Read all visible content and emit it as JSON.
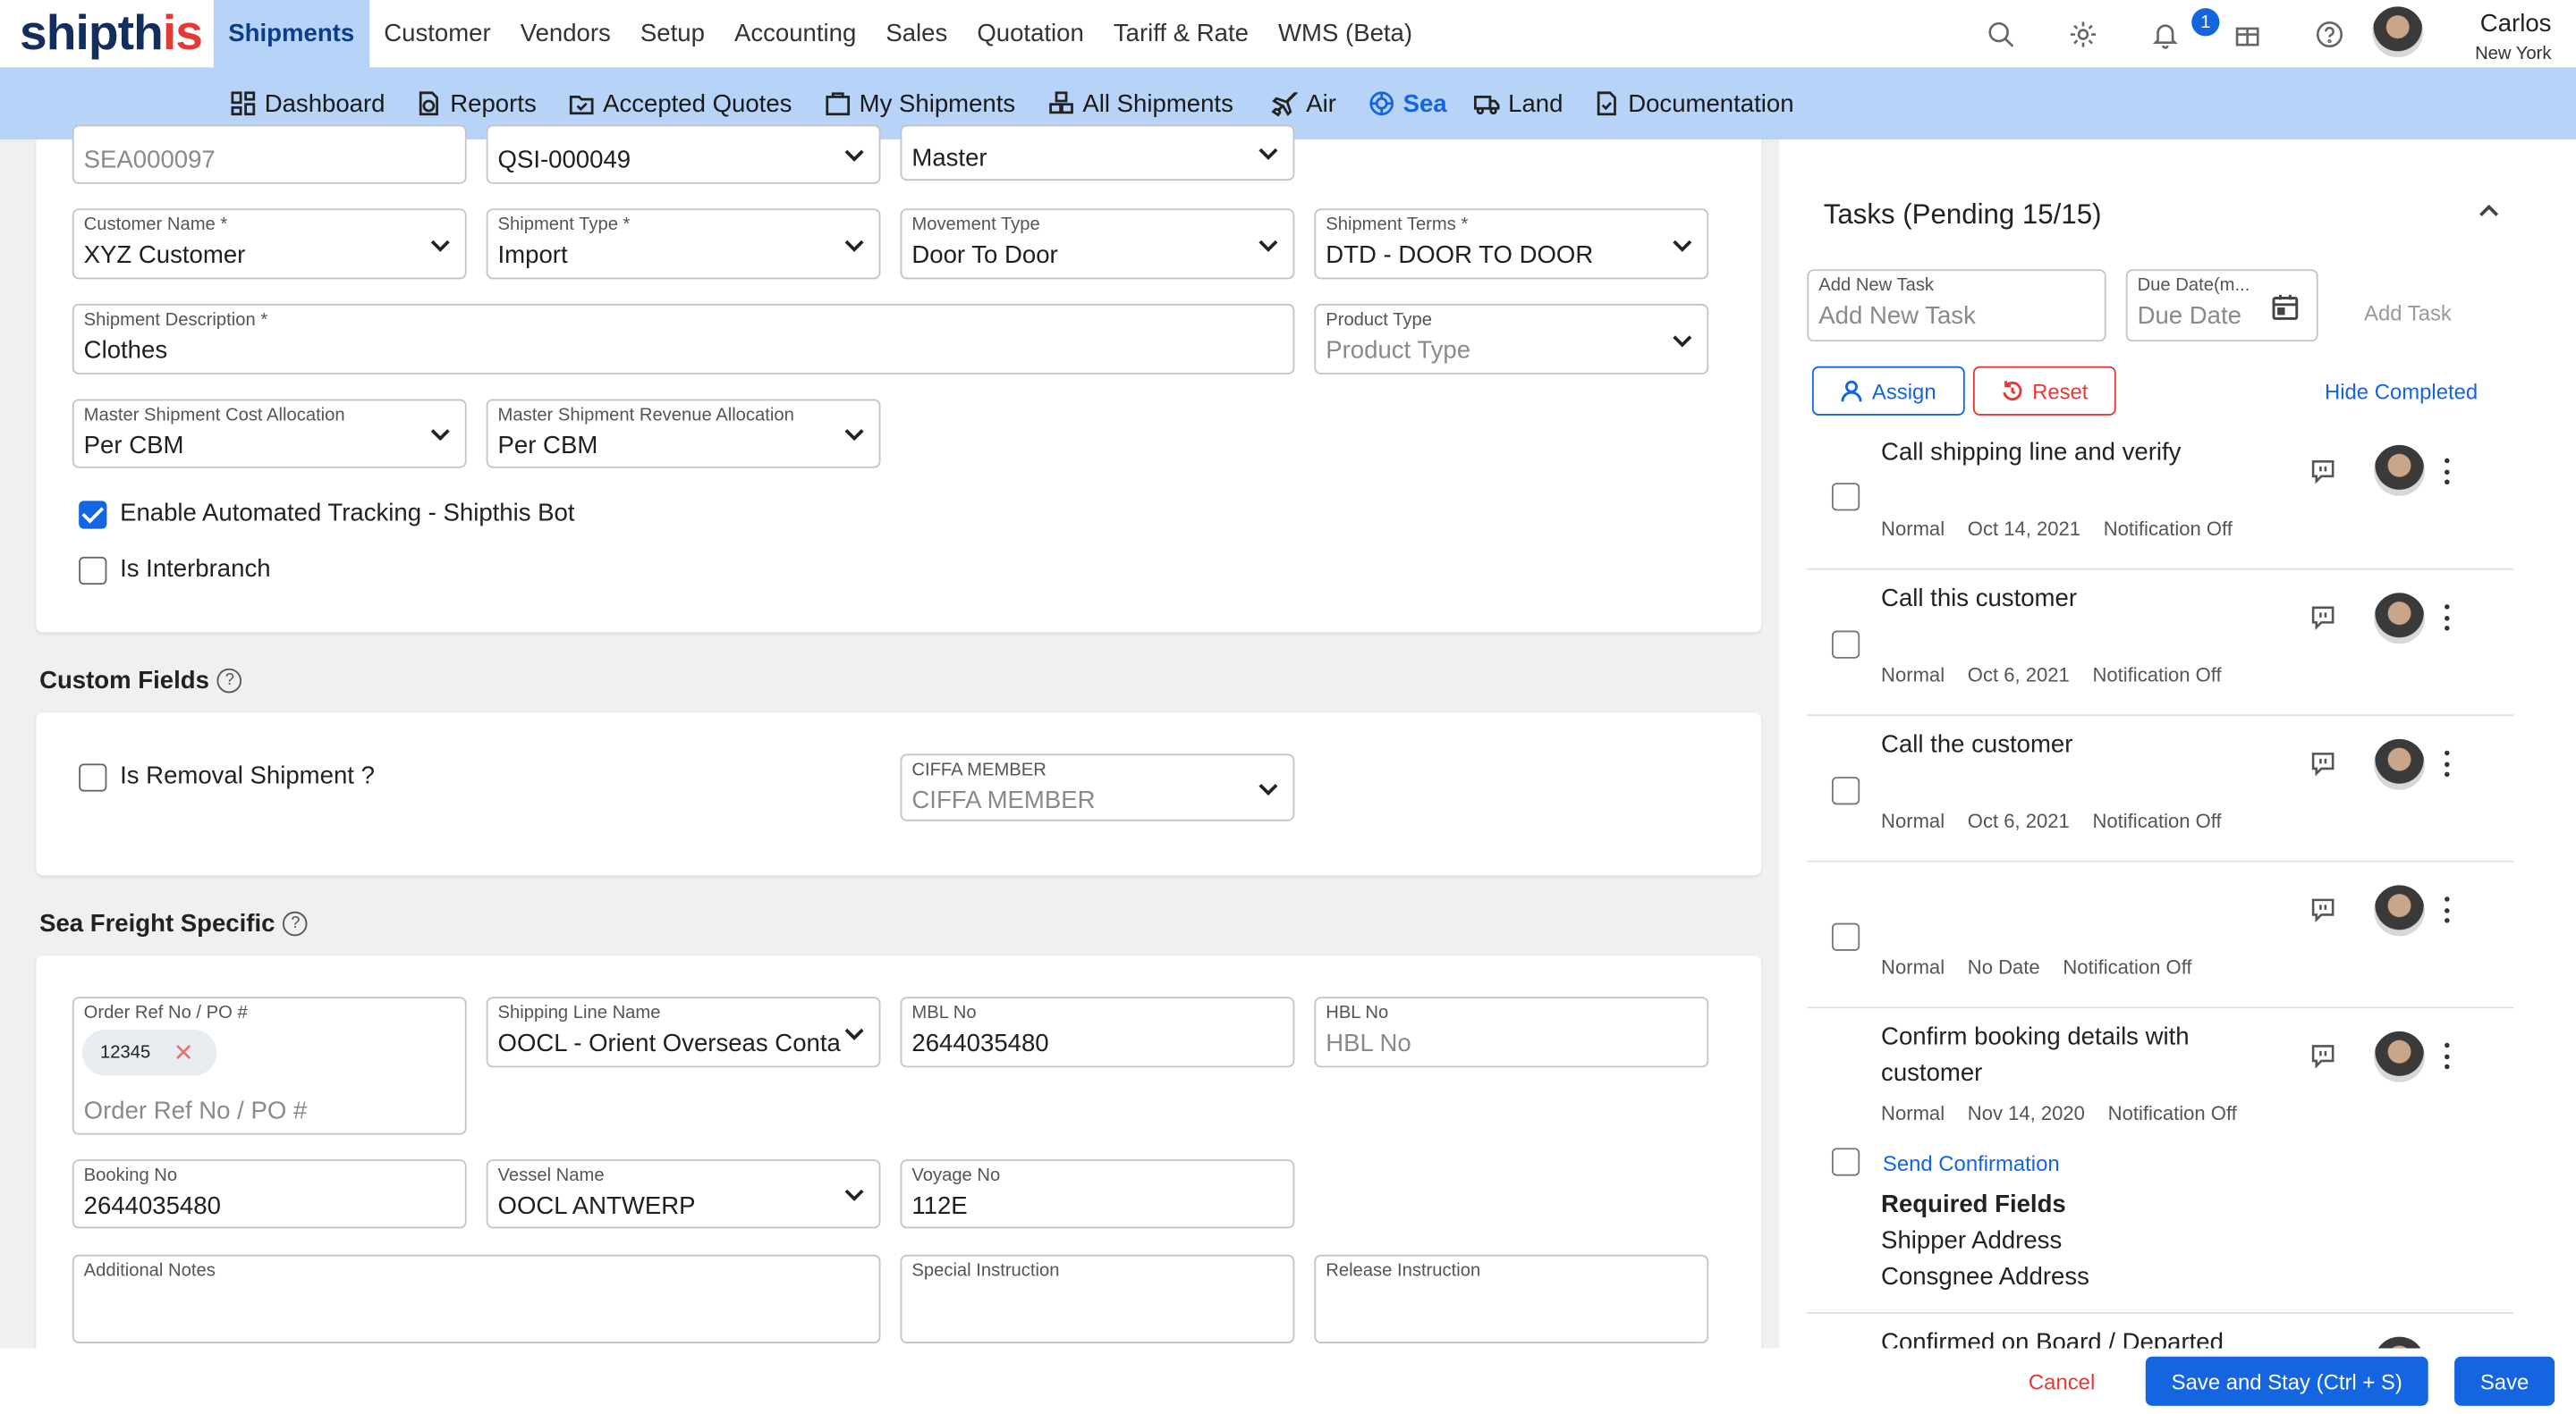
{
  "app": {
    "brand_main": "shipth",
    "brand_accent": "is"
  },
  "main_menu": [
    "Shipments",
    "Customer",
    "Vendors",
    "Setup",
    "Accounting",
    "Sales",
    "Quotation",
    "Tariff & Rate",
    "WMS (Beta)"
  ],
  "notifications_count": "1",
  "user": {
    "name": "Carlos",
    "location": "New York"
  },
  "sub_menu": [
    {
      "label": "Dashboard",
      "icon": "dashboard-icon"
    },
    {
      "label": "Reports",
      "icon": "reports-icon"
    },
    {
      "label": "Accepted Quotes",
      "icon": "accepted-quotes-icon"
    },
    {
      "label": "My Shipments",
      "icon": "my-shipments-icon"
    },
    {
      "label": "All Shipments",
      "icon": "all-shipments-icon"
    },
    {
      "label": "Air",
      "icon": "airplane-icon"
    },
    {
      "label": "Sea",
      "icon": "sea-icon"
    },
    {
      "label": "Land",
      "icon": "truck-icon"
    },
    {
      "label": "Documentation",
      "icon": "documentation-icon"
    }
  ],
  "form": {
    "shipment_no": "SEA000097",
    "quotation_no": "QSI-000049",
    "master_type": "Master",
    "customer_name": {
      "label": "Customer Name *",
      "value": "XYZ Customer"
    },
    "shipment_type": {
      "label": "Shipment Type *",
      "value": "Import"
    },
    "movement_type": {
      "label": "Movement Type",
      "value": "Door To Door"
    },
    "shipment_terms": {
      "label": "Shipment Terms *",
      "value": "DTD - DOOR TO DOOR"
    },
    "shipment_description": {
      "label": "Shipment Description *",
      "value": "Clothes"
    },
    "product_type": {
      "label": "Product Type",
      "placeholder": "Product Type"
    },
    "cost_allocation": {
      "label": "Master Shipment Cost Allocation",
      "value": "Per CBM"
    },
    "revenue_allocation": {
      "label": "Master Shipment Revenue Allocation",
      "value": "Per CBM"
    },
    "automated_tracking": "Enable Automated Tracking - Shipthis Bot",
    "is_interbranch": "Is Interbranch"
  },
  "custom_fields": {
    "title": "Custom Fields",
    "removal": "Is Removal Shipment ?",
    "ciffa": {
      "label": "CIFFA MEMBER",
      "placeholder": "CIFFA MEMBER"
    }
  },
  "sea_freight": {
    "title": "Sea Freight Specific",
    "order_ref": {
      "label": "Order Ref No / PO #",
      "chip": "12345",
      "placeholder": "Order Ref No / PO #"
    },
    "shipping_line": {
      "label": "Shipping Line Name",
      "value": "OOCL - Orient Overseas Conta"
    },
    "mbl": {
      "label": "MBL No",
      "value": "2644035480"
    },
    "hbl": {
      "label": "HBL No",
      "placeholder": "HBL No"
    },
    "booking": {
      "label": "Booking No",
      "value": "2644035480"
    },
    "vessel": {
      "label": "Vessel Name",
      "value": "OOCL ANTWERP"
    },
    "voyage": {
      "label": "Voyage No",
      "value": "112E"
    },
    "additional_notes": {
      "label": "Additional Notes"
    },
    "special_instruction": {
      "label": "Special Instruction"
    },
    "release_instruction": {
      "label": "Release Instruction"
    }
  },
  "tasks": {
    "title": "Tasks (Pending 15/15)",
    "new_task": {
      "label": "Add New Task",
      "placeholder": "Add New Task"
    },
    "due_date": {
      "label": "Due Date(m...",
      "placeholder": "Due Date"
    },
    "add_task": "Add Task",
    "assign": "Assign",
    "reset": "Reset",
    "hide_completed": "Hide Completed",
    "items": [
      {
        "title": "Call shipping line and verify",
        "priority": "Normal",
        "date": "Oct 14, 2021",
        "notification": "Notification Off"
      },
      {
        "title": "Call this customer",
        "priority": "Normal",
        "date": "Oct 6, 2021",
        "notification": "Notification Off"
      },
      {
        "title": "Call the customer",
        "priority": "Normal",
        "date": "Oct 6, 2021",
        "notification": "Notification Off"
      },
      {
        "title": "",
        "priority": "Normal",
        "date": "No Date",
        "notification": "Notification Off"
      },
      {
        "title": "Confirm booking details with customer",
        "priority": "Normal",
        "date": "Nov 14, 2020",
        "notification": "Notification Off",
        "action": "Send Confirmation",
        "required_title": "Required Fields",
        "required": [
          "Shipper Address",
          "Consgnee Address"
        ]
      },
      {
        "title": "Confirmed on Board / Departed"
      }
    ]
  },
  "footer": {
    "cancel": "Cancel",
    "save_stay": "Save and Stay (Ctrl + S)",
    "save": "Save"
  },
  "colors": {
    "accent": "#1565e0",
    "nav_bg": "#b7d3f7",
    "danger": "#e53935"
  }
}
